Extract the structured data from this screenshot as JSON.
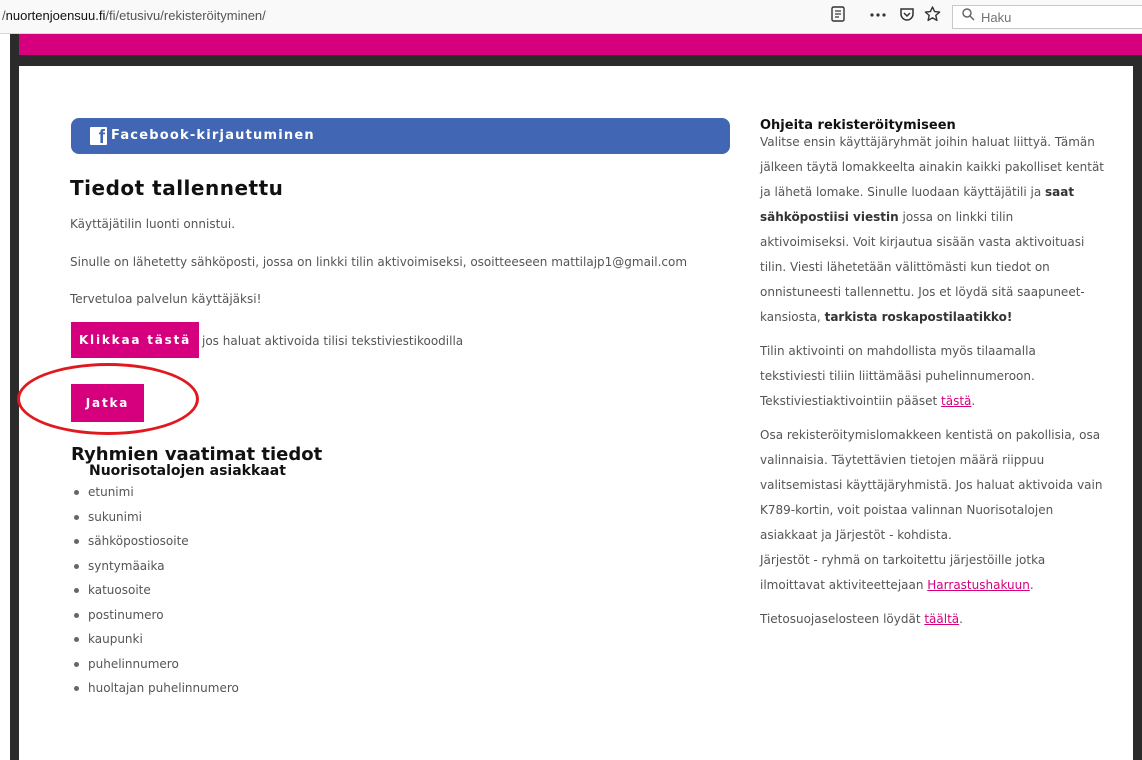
{
  "browser": {
    "url_prefix": "/",
    "url_domain": "nuortenjoensuu.fi",
    "url_path": "/fi/etusivu/rekisteröityminen/",
    "search_placeholder": "Haku"
  },
  "colors": {
    "brand_pink": "#d6007f",
    "facebook_blue": "#4166b3",
    "annotation_red": "#e0191e"
  },
  "facebook": {
    "label": "Facebook-kirjautuminen",
    "icon": "facebook-icon"
  },
  "saved": {
    "title": "Tiedot tallennettu",
    "success": "Käyttäjätilin luonti onnistui.",
    "email_notice": "Sinulle on lähetetty sähköposti, jossa on linkki tilin aktivoimiseksi, osoitteeseen mattilajp1@gmail.com",
    "welcome": "Tervetuloa palvelun käyttäjäksi!"
  },
  "actions": {
    "click_here_label": "Klikkaa tästä",
    "sms_text": "jos haluat aktivoida tilisi tekstiviestikoodilla",
    "continue_label": "Jatka"
  },
  "groups": {
    "title": "Ryhmien vaatimat tiedot",
    "subtitle": "Nuorisotalojen asiakkaat",
    "fields": [
      "etunimi",
      "sukunimi",
      "sähköpostiosoite",
      "syntymäaika",
      "katuosoite",
      "postinumero",
      "kaupunki",
      "puhelinnumero",
      "huoltajan puhelinnumero"
    ]
  },
  "help": {
    "title": "Ohjeita rekisteröitymiseen",
    "p1_a": "Valitse ensin käyttäjäryhmät joihin haluat liittyä. Tämän jälkeen täytä lomakkeelta ainakin kaikki pakolliset kentät ja lähetä lomake. Sinulle luodaan käyttäjätili ja ",
    "p1_b": "saat sähköpostiisi viestin",
    "p1_c": " jossa on linkki tilin aktivoimiseksi. Voit kirjautua sisään vasta aktivoituasi tilin.  Viesti lähetetään välittömästi kun tiedot on onnistuneesti tallennettu. Jos et löydä sitä saapuneet-kansiosta, ",
    "p1_d": "tarkista roskapostilaatikko!",
    "p2": "Tilin aktivointi on mahdollista myös tilaamalla tekstiviesti tiliin liittämääsi puhelinnumeroon. Tekstiviestiaktivointiin pääset ",
    "p2_link": "tästä",
    "p2_end": ".",
    "p3": "Osa rekisteröitymislomakkeen kentistä on pakollisia, osa valinnaisia. Täytettävien tietojen määrä riippuu valitsemistasi käyttäjäryhmistä. Jos haluat aktivoida vain K789-kortin, voit poistaa valinnan Nuorisotalojen asiakkaat ja Järjestöt - kohdista.",
    "p4": "Järjestöt - ryhmä on tarkoitettu järjestöille jotka ilmoittavat aktiviteettejaan ",
    "p4_link": "Harrastushakuun",
    "p4_end": ".",
    "p5": "Tietosuojaselosteen löydät ",
    "p5_link": "täältä",
    "p5_end": "."
  }
}
